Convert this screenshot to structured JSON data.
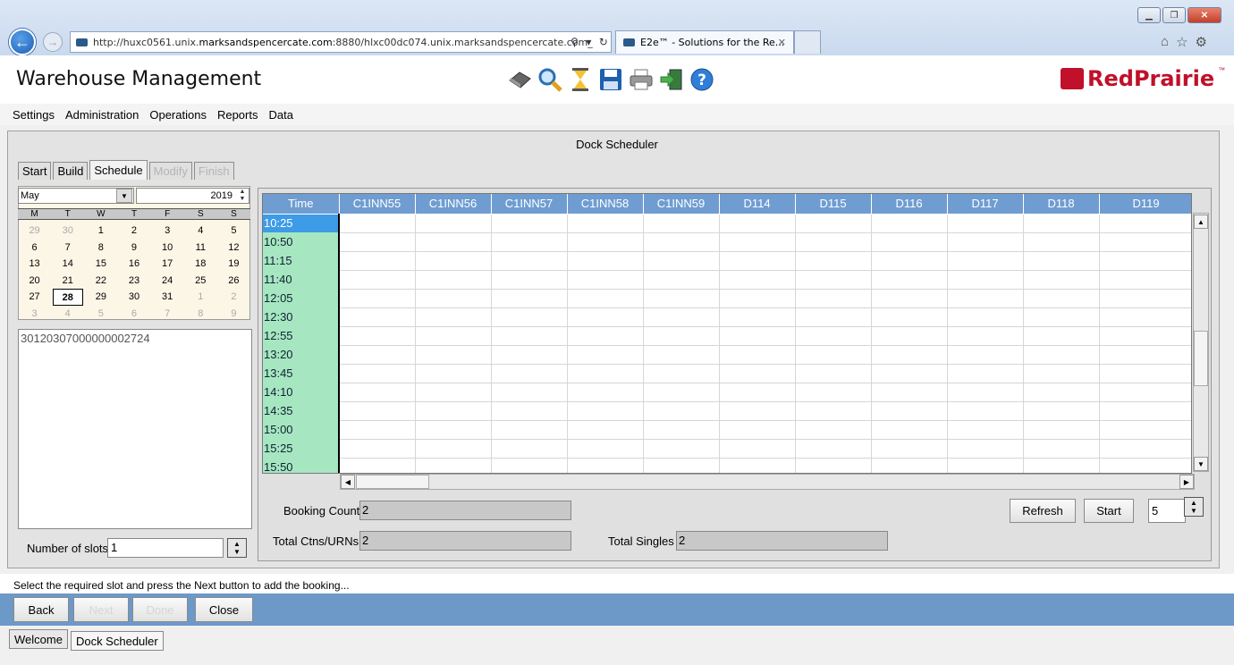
{
  "browser": {
    "url_prefix": "http://huxc0561.unix.",
    "url_domain": "marksandspencercate.com",
    "url_suffix": ":8880/hlxc00dc074.unix.marksandspencercate.com_",
    "tab_title": "E2e™ - Solutions for the Re...",
    "icons": [
      "back-arrow-icon",
      "forward-arrow-icon",
      "search-icon",
      "refresh-icon",
      "home-icon",
      "star-icon",
      "gear-icon"
    ]
  },
  "app": {
    "title": "Warehouse Management",
    "logo_text": "RedPrairie",
    "logo_tm": "™",
    "brand_color": "#c0102a",
    "toolbar_icons": [
      "eraser-icon",
      "search-icon",
      "hourglass-icon",
      "save-icon",
      "print-icon",
      "exit-icon",
      "help-icon"
    ]
  },
  "menu": [
    "Settings",
    "Administration",
    "Operations",
    "Reports",
    "Data"
  ],
  "form": {
    "title": "Dock Scheduler",
    "tabs": [
      {
        "label": "Start",
        "state": "normal"
      },
      {
        "label": "Build",
        "state": "normal"
      },
      {
        "label": "Schedule",
        "state": "active"
      },
      {
        "label": "Modify",
        "state": "disabled"
      },
      {
        "label": "Finish",
        "state": "disabled"
      }
    ]
  },
  "calendar": {
    "month": "May",
    "year": "2019",
    "weekdays": [
      "M",
      "T",
      "W",
      "T",
      "F",
      "S",
      "S"
    ],
    "weeks": [
      [
        {
          "d": "29",
          "o": true
        },
        {
          "d": "30",
          "o": true
        },
        {
          "d": "1"
        },
        {
          "d": "2"
        },
        {
          "d": "3"
        },
        {
          "d": "4"
        },
        {
          "d": "5"
        }
      ],
      [
        {
          "d": "6"
        },
        {
          "d": "7"
        },
        {
          "d": "8"
        },
        {
          "d": "9"
        },
        {
          "d": "10"
        },
        {
          "d": "11"
        },
        {
          "d": "12"
        }
      ],
      [
        {
          "d": "13"
        },
        {
          "d": "14"
        },
        {
          "d": "15"
        },
        {
          "d": "16"
        },
        {
          "d": "17"
        },
        {
          "d": "18"
        },
        {
          "d": "19"
        }
      ],
      [
        {
          "d": "20"
        },
        {
          "d": "21"
        },
        {
          "d": "22"
        },
        {
          "d": "23"
        },
        {
          "d": "24"
        },
        {
          "d": "25"
        },
        {
          "d": "26"
        }
      ],
      [
        {
          "d": "27"
        },
        {
          "d": "28",
          "today": true
        },
        {
          "d": "29"
        },
        {
          "d": "30"
        },
        {
          "d": "31"
        },
        {
          "d": "1",
          "o": true
        },
        {
          "d": "2",
          "o": true
        }
      ],
      [
        {
          "d": "3",
          "o": true
        },
        {
          "d": "4",
          "o": true
        },
        {
          "d": "5",
          "o": true
        },
        {
          "d": "6",
          "o": true
        },
        {
          "d": "7",
          "o": true
        },
        {
          "d": "8",
          "o": true
        },
        {
          "d": "9",
          "o": true
        }
      ]
    ]
  },
  "list": [
    "30120307000000002724"
  ],
  "slots": {
    "label": "Number of slots",
    "value": "1"
  },
  "schedule": {
    "columns": [
      "Time",
      "C1INN55",
      "C1INN56",
      "C1INN57",
      "C1INN58",
      "C1INN59",
      "D114",
      "D115",
      "D116",
      "D117",
      "D118",
      "D119"
    ],
    "times": [
      "10:25",
      "10:50",
      "11:15",
      "11:40",
      "12:05",
      "12:30",
      "12:55",
      "13:20",
      "13:45",
      "14:10",
      "14:35",
      "15:00",
      "15:25",
      "15:50"
    ],
    "selected_time": "10:25",
    "header_color": "#6f9dd2",
    "time_color": "#a6e7c1"
  },
  "fields": {
    "booking_count": {
      "label": "Booking Count",
      "value": "2"
    },
    "total_ctns": {
      "label": "Total Ctns/URNs",
      "value": "2"
    },
    "total_singles": {
      "label": "Total Singles",
      "value": "2"
    }
  },
  "controls": {
    "refresh": "Refresh",
    "start": "Start",
    "interval": "5"
  },
  "status_message": "Select the required slot and press the Next button to add the booking...",
  "buttons": {
    "back": "Back",
    "next": "Next",
    "done": "Done",
    "close": "Close"
  },
  "bottom_tabs": [
    "Welcome",
    "Dock Scheduler"
  ]
}
